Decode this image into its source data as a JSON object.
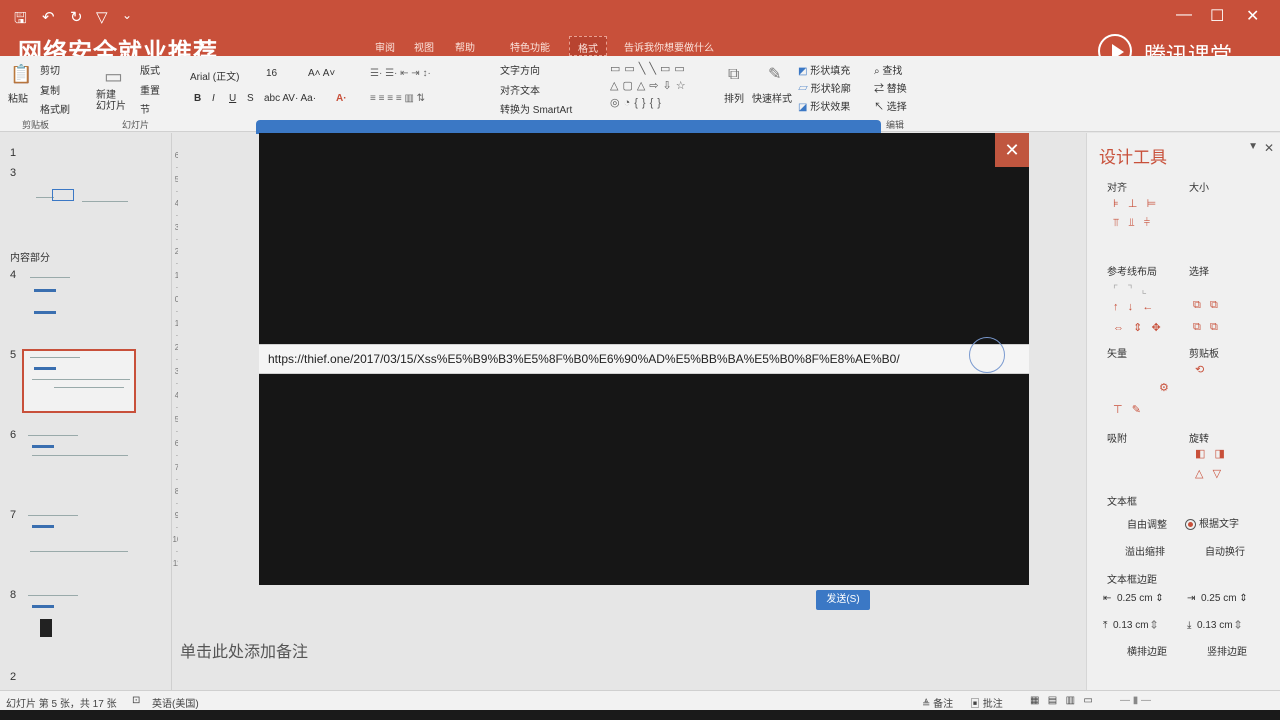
{
  "titlebar": {
    "quick_access": [
      "save-icon",
      "undo-icon",
      "redo-icon",
      "customize-icon"
    ],
    "doc_title": ""
  },
  "banner": {
    "text": "网络安全就业推荐"
  },
  "brand": {
    "name": "腾讯课堂"
  },
  "tabs": {
    "items": [
      "审阅",
      "视图",
      "帮助",
      "特色功能",
      "格式"
    ],
    "active_index": 4,
    "tell_me": "告诉我你想要做什么"
  },
  "ribbon": {
    "clipboard": {
      "paste": "粘贴",
      "cut": "剪切",
      "copy": "复制",
      "format_painter": "格式刷",
      "label": "剪贴板"
    },
    "slides": {
      "new_slide": "新建\n幻灯片",
      "layout": "版式",
      "reset": "重置",
      "section": "节",
      "label": "幻灯片"
    },
    "font": {
      "family": "Arial (正文)",
      "size": "16",
      "bold": "B",
      "italic": "I",
      "underline": "U",
      "shadow": "S"
    },
    "paragraph": {
      "text_direction": "文字方向",
      "align_text": "对齐文本",
      "smartart": "转换为 SmartArt"
    },
    "drawing": {
      "arrange": "排列",
      "quick_styles": "快速样式",
      "fill": "形状填充",
      "outline": "形状轮廓",
      "effects": "形状效果"
    },
    "editing": {
      "find": "查找",
      "replace": "替换",
      "select": "选择",
      "label": "编辑"
    }
  },
  "thumbnails": {
    "sections": [
      {
        "name": "",
        "slide_numbers": [
          "1",
          "3"
        ]
      },
      {
        "name": "内容部分",
        "slide_numbers": [
          "4",
          "5",
          "6",
          "7",
          "8"
        ]
      }
    ],
    "selected_slide": "5",
    "bottom_number": "2"
  },
  "dialog": {
    "url": "https://thief.one/2017/03/15/Xss%E5%B9%B3%E5%8F%B0%E6%90%AD%E5%BB%BA%E5%B0%8F%E8%AE%B0/",
    "close_label": "✕"
  },
  "send_button": "发送(S)",
  "notes_placeholder": "单击此处添加备注",
  "design_panel": {
    "title": "设计工具",
    "align_label": "对齐",
    "size_label": "大小",
    "guides_label": "参考线布局",
    "select_label": "选择",
    "vector_label": "矢量",
    "clipboard_label": "剪贴板",
    "snap_label": "吸附",
    "rotate_label": "旋转",
    "textbox_label": "文本框",
    "free_adjust": "自由调整",
    "fit_text": "根据文字",
    "overflow_shrink": "溢出缩排",
    "auto_wrap": "自动换行",
    "margins_label": "文本框边距",
    "margin_left": "0.25 cm",
    "margin_right": "0.25 cm",
    "margin_top": "0.13 cm",
    "margin_bottom": "0.13 cm",
    "lr_margin": "横排边距",
    "tb_margin": "竖排边距"
  },
  "status": {
    "slide_info": "幻灯片 第 5 张，共 17 张",
    "language": "英语(美国)",
    "notes": "备注",
    "comments": "批注"
  },
  "colors": {
    "accent": "#c8503a",
    "blue": "#3b78c5"
  }
}
